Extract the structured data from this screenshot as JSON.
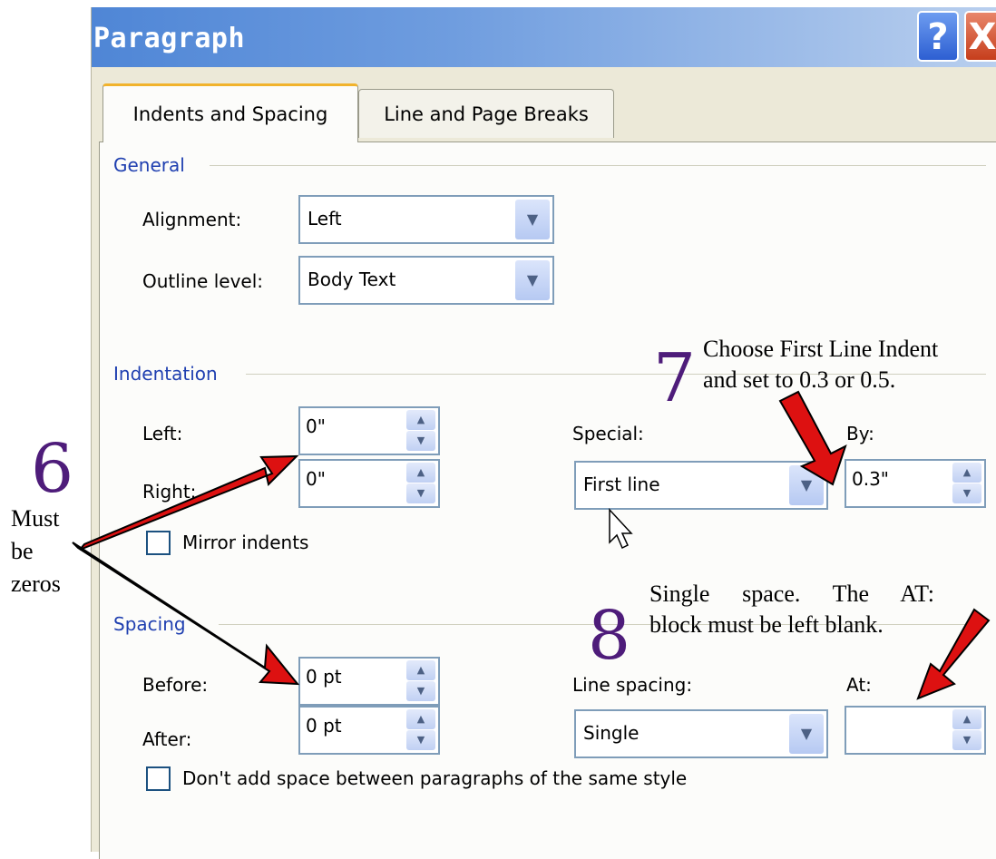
{
  "window": {
    "title": "Paragraph",
    "help_label": "?",
    "close_label": "X"
  },
  "tabs": [
    {
      "label": "Indents and Spacing",
      "active": true
    },
    {
      "label": "Line and Page Breaks",
      "active": false
    }
  ],
  "general": {
    "title": "General",
    "alignment_label": "Alignment:",
    "alignment_value": "Left",
    "outline_label": "Outline level:",
    "outline_value": "Body Text"
  },
  "indentation": {
    "title": "Indentation",
    "left_label": "Left:",
    "left_value": "0\"",
    "right_label": "Right:",
    "right_value": "0\"",
    "special_label": "Special:",
    "special_value": "First line",
    "by_label": "By:",
    "by_value": "0.3\"",
    "mirror_label": "Mirror indents",
    "mirror_checked": false
  },
  "spacing": {
    "title": "Spacing",
    "before_label": "Before:",
    "before_value": "0 pt",
    "after_label": "After:",
    "after_value": "0 pt",
    "line_spacing_label": "Line spacing:",
    "line_spacing_value": "Single",
    "at_label": "At:",
    "at_value": "",
    "dont_add_label": "Don't add space between paragraphs of the same style",
    "dont_add_checked": false
  },
  "annotations": {
    "step6_number": "6",
    "step6_text_1": "Must",
    "step6_text_2": "be",
    "step6_text_3": "zeros",
    "step7_number": "7",
    "step7_text_1": "Choose First Line Indent",
    "step7_text_2": "and set to 0.3 or 0.5.",
    "step8_number": "8",
    "step8_text_1": "Single space. The AT:",
    "step8_text_2": "block must be left blank.",
    "arrow_color": "#dd1111",
    "number_color": "#4e1c7a"
  }
}
